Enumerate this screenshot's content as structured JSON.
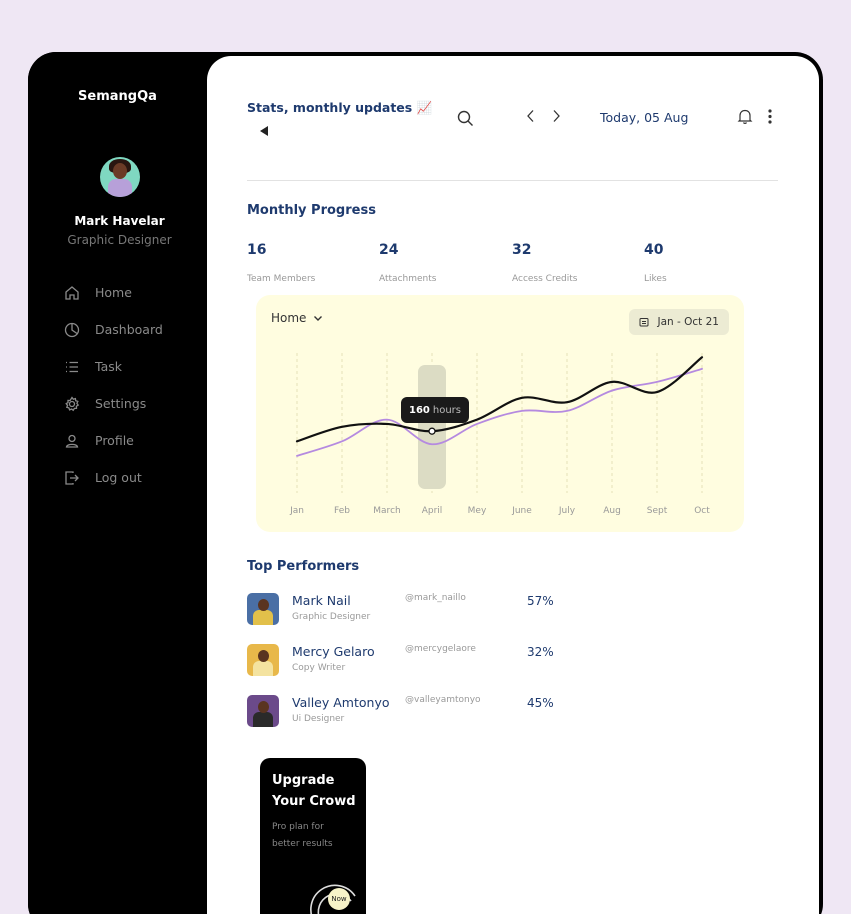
{
  "sidebar": {
    "brand": "SemangQa",
    "user": {
      "name": "Mark Havelar",
      "role": "Graphic Designer"
    },
    "items": [
      {
        "label": "Home",
        "icon": "home-icon"
      },
      {
        "label": "Dashboard",
        "icon": "pie-chart-icon"
      },
      {
        "label": "Task",
        "icon": "list-icon"
      },
      {
        "label": "Settings",
        "icon": "gear-icon"
      },
      {
        "label": "Profile",
        "icon": "user-icon"
      },
      {
        "label": "Log out",
        "icon": "logout-icon"
      }
    ]
  },
  "header": {
    "title": "Stats, monthly updates 📈",
    "date": "Today, 05 Aug"
  },
  "progress": {
    "title": "Monthly Progress",
    "stats": [
      {
        "value": "16",
        "label": "Team Members"
      },
      {
        "value": "24",
        "label": "Attachments"
      },
      {
        "value": "32",
        "label": "Access Credits"
      },
      {
        "value": "40",
        "label": "Likes"
      }
    ]
  },
  "chart_data": {
    "type": "line",
    "selector": "Home",
    "range": "Jan - Oct 21",
    "categories": [
      "Jan",
      "Feb",
      "March",
      "April",
      "Mey",
      "June",
      "July",
      "Aug",
      "Sept",
      "Oct"
    ],
    "series": [
      {
        "color": "#111111",
        "values": [
          37,
          47,
          49,
          44,
          52,
          67,
          64,
          78,
          71,
          95
        ]
      },
      {
        "color": "#b58ae0",
        "values": [
          27,
          37,
          52,
          35,
          49,
          58,
          58,
          72,
          78,
          87
        ]
      }
    ],
    "highlight": {
      "category": "April",
      "value_label": "160",
      "unit_label": "hours"
    },
    "ylim": [
      0,
      100
    ],
    "grid": "vertical dashed"
  },
  "performers": {
    "title": "Top Performers",
    "rows": [
      {
        "name": "Mark Nail",
        "role": "Graphic Designer",
        "handle": "@mark_naillo",
        "percent": "57%",
        "avatar_color": "#4a6fa5"
      },
      {
        "name": "Mercy Gelaro",
        "role": "Copy Writer",
        "handle": "@mercygelaore",
        "percent": "32%",
        "avatar_color": "#e8b84a"
      },
      {
        "name": "Valley Amtonyo",
        "role": "Ui Designer",
        "handle": "@valleyamtonyo",
        "percent": "45%",
        "avatar_color": "#6b4a8a"
      }
    ]
  },
  "upgrade": {
    "title": "Upgrade Your Crowd",
    "subtitle": "Pro plan for better results",
    "button": "Now"
  }
}
